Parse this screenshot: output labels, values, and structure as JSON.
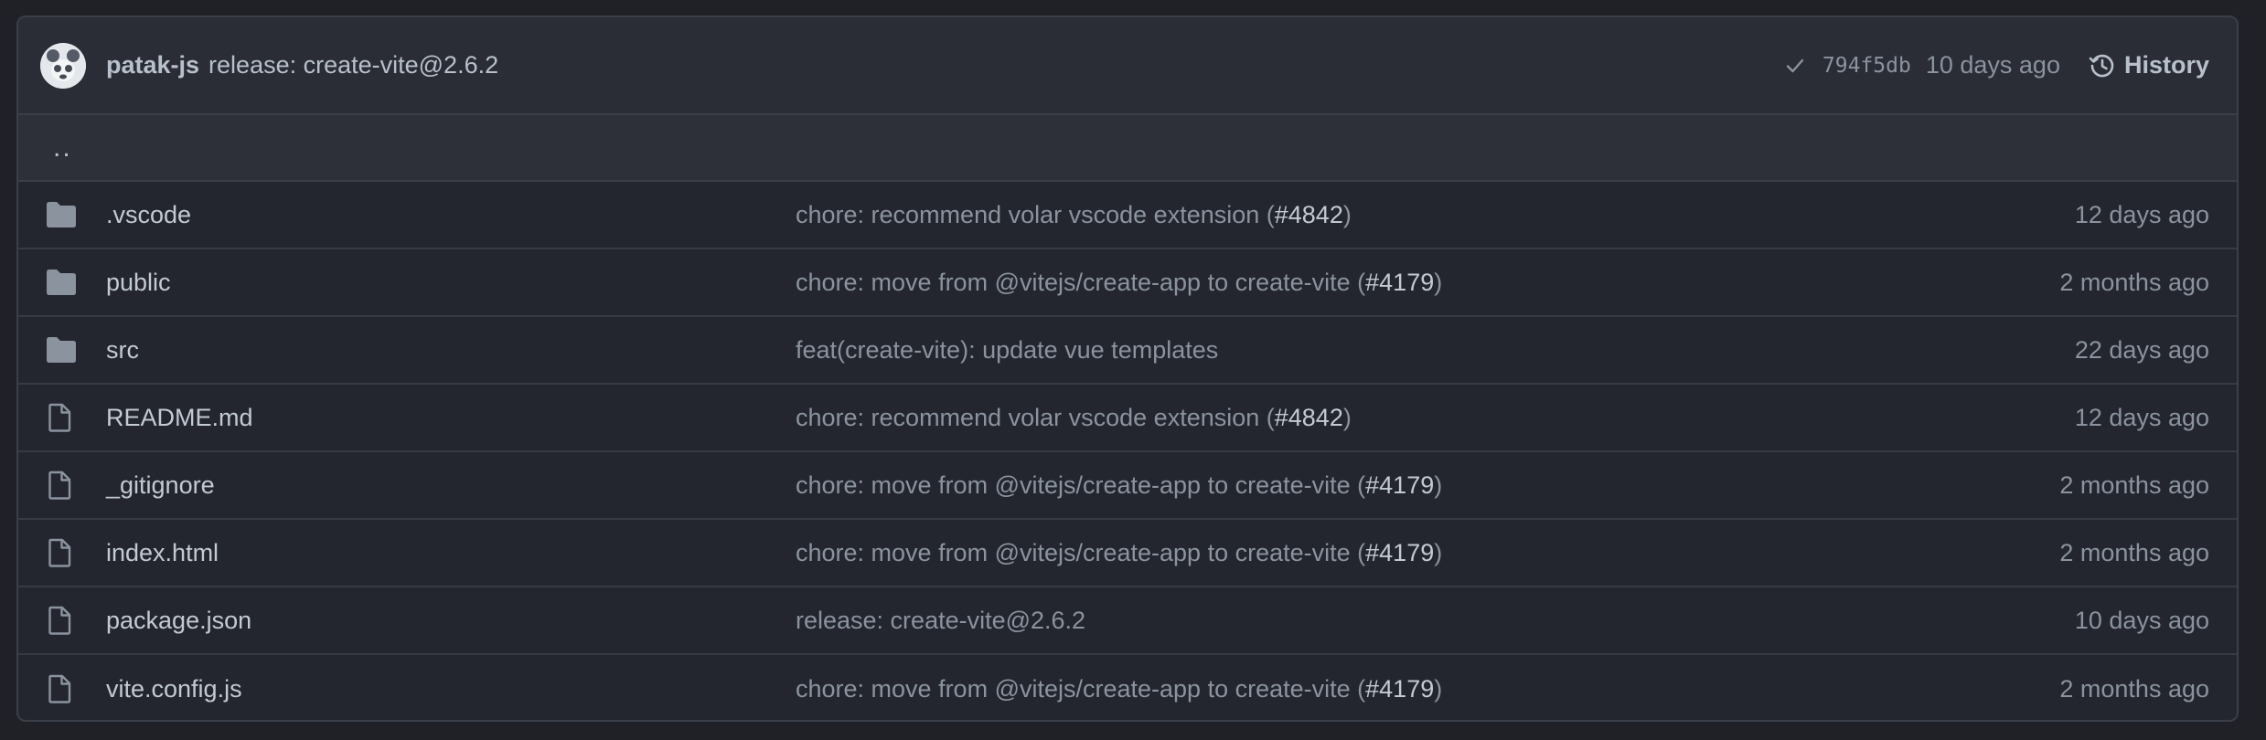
{
  "header": {
    "author": "patak-js",
    "message": "release: create-vite@2.6.2",
    "sha": "794f5db",
    "time": "10 days ago",
    "history_label": "History",
    "icons": {
      "status": "check-icon",
      "history": "history-clock-icon",
      "avatar": "avatar"
    }
  },
  "parent_dir": {
    "label": ".."
  },
  "files": [
    {
      "name": ".vscode",
      "type": "folder",
      "icon": "folder-icon",
      "message": "chore: recommend volar vscode extension (",
      "pr": "#4842",
      "message_end": ")",
      "age": "12 days ago"
    },
    {
      "name": "public",
      "type": "folder",
      "icon": "folder-icon",
      "message": "chore: move from @vitejs/create-app to create-vite (",
      "pr": "#4179",
      "message_end": ")",
      "age": "2 months ago"
    },
    {
      "name": "src",
      "type": "folder",
      "icon": "folder-icon",
      "message": "feat(create-vite): update vue templates",
      "pr": "",
      "message_end": "",
      "age": "22 days ago"
    },
    {
      "name": "README.md",
      "type": "file",
      "icon": "file-icon",
      "message": "chore: recommend volar vscode extension (",
      "pr": "#4842",
      "message_end": ")",
      "age": "12 days ago"
    },
    {
      "name": "_gitignore",
      "type": "file",
      "icon": "file-icon",
      "message": "chore: move from @vitejs/create-app to create-vite (",
      "pr": "#4179",
      "message_end": ")",
      "age": "2 months ago"
    },
    {
      "name": "index.html",
      "type": "file",
      "icon": "file-icon",
      "message": "chore: move from @vitejs/create-app to create-vite (",
      "pr": "#4179",
      "message_end": ")",
      "age": "2 months ago"
    },
    {
      "name": "package.json",
      "type": "file",
      "icon": "file-icon",
      "message": "release: create-vite@2.6.2",
      "pr": "",
      "message_end": "",
      "age": "10 days ago"
    },
    {
      "name": "vite.config.js",
      "type": "file",
      "icon": "file-icon",
      "message": "chore: move from @vitejs/create-app to create-vite (",
      "pr": "#4179",
      "message_end": ")",
      "age": "2 months ago"
    }
  ],
  "colors": {
    "background": "#1f2126",
    "panel": "#23262e",
    "header": "#2a2d35",
    "border": "#3a3f48",
    "text": "#c3cad4",
    "muted": "#8b939f"
  }
}
